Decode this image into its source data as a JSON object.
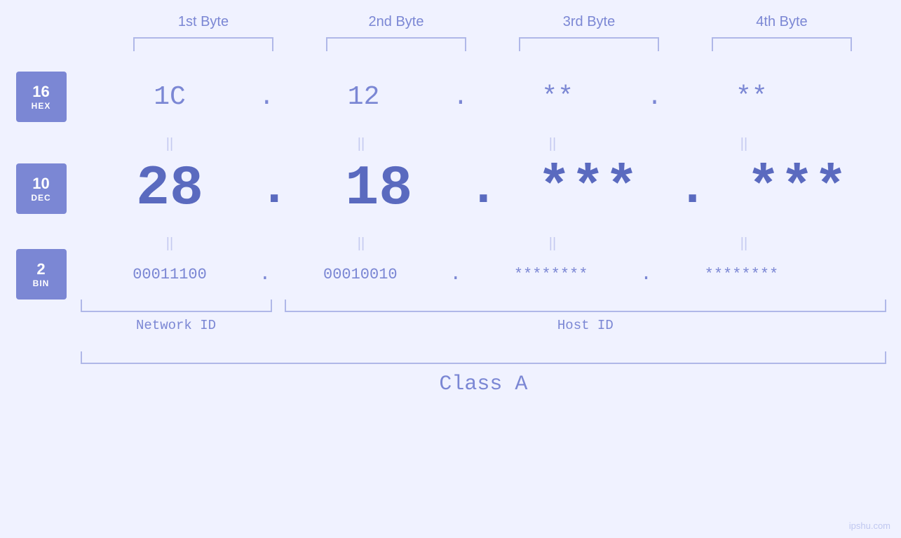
{
  "page": {
    "background": "#f0f2ff",
    "watermark": "ipshu.com"
  },
  "byteHeaders": [
    {
      "label": "1st Byte"
    },
    {
      "label": "2nd Byte"
    },
    {
      "label": "3rd Byte"
    },
    {
      "label": "4th Byte"
    }
  ],
  "badges": [
    {
      "number": "16",
      "base": "HEX"
    },
    {
      "number": "10",
      "base": "DEC"
    },
    {
      "number": "2",
      "base": "BIN"
    }
  ],
  "rows": {
    "hex": {
      "values": [
        "1C",
        "12",
        "**",
        "**"
      ],
      "dot": "."
    },
    "dec": {
      "values": [
        "28",
        "18",
        "***",
        "***"
      ],
      "dot": "."
    },
    "bin": {
      "values": [
        "00011100",
        "00010010",
        "********",
        "********"
      ],
      "dot": "."
    }
  },
  "equalsSign": "||",
  "networkId": "Network ID",
  "hostId": "Host ID",
  "classLabel": "Class A"
}
